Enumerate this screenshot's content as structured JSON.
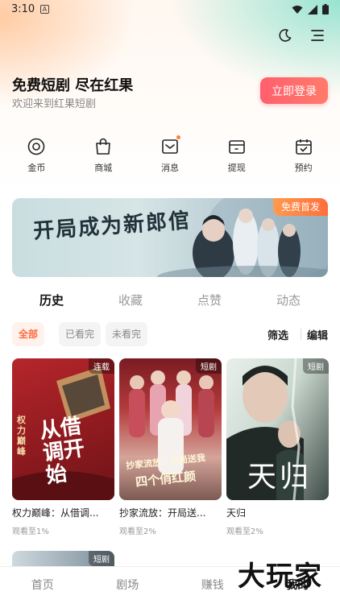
{
  "status_bar": {
    "time": "3:10",
    "notification_badge": "A",
    "icons": [
      "wifi-icon",
      "signal-icon",
      "battery-icon"
    ]
  },
  "header": {
    "icons": [
      "moon-icon",
      "menu-icon"
    ]
  },
  "hero": {
    "title": "免费短剧 尽在红果",
    "subtitle": "欢迎来到红果短剧",
    "login_label": "立即登录"
  },
  "quick_menu": [
    {
      "label": "金币",
      "icon": "coin-icon"
    },
    {
      "label": "商城",
      "icon": "shopping-bag-icon"
    },
    {
      "label": "消息",
      "icon": "message-icon",
      "has_dot": true
    },
    {
      "label": "提现",
      "icon": "wallet-icon"
    },
    {
      "label": "预约",
      "icon": "calendar-icon"
    }
  ],
  "banner": {
    "calligraphy": "开局成为新郎倌",
    "badge": "免费首发"
  },
  "tabs": [
    {
      "label": "历史",
      "active": true
    },
    {
      "label": "收藏",
      "active": false
    },
    {
      "label": "点赞",
      "active": false
    },
    {
      "label": "动态",
      "active": false
    }
  ],
  "filters": {
    "chips": [
      {
        "label": "全部",
        "active": true
      },
      {
        "label": "已看完",
        "active": false
      },
      {
        "label": "未看完",
        "active": false
      }
    ],
    "filter_label": "筛选",
    "edit_label": "编辑"
  },
  "cards": [
    {
      "title": "权力巅峰：从借调...",
      "progress": "观看至1%",
      "tag": "连载",
      "poster_text": "从借调开始",
      "poster_side": "权力巅峰"
    },
    {
      "title": "抄家流放：开局送...",
      "progress": "观看至2%",
      "tag": "短剧",
      "poster_text": "抄家流放：开局送我",
      "poster_text2": "四个俏红颜"
    },
    {
      "title": "天归",
      "progress": "观看至2%",
      "tag": "短剧",
      "poster_text": "天归"
    }
  ],
  "next_card": {
    "tag": "短剧"
  },
  "bottom_nav": [
    {
      "label": "首页",
      "active": false
    },
    {
      "label": "剧场",
      "active": false
    },
    {
      "label": "赚钱",
      "active": false
    },
    {
      "label": "我的",
      "active": true
    }
  ],
  "watermark": "大玩家",
  "colors": {
    "accent": "#ff6a3d",
    "login_gradient_start": "#ff5f6d",
    "badge_orange": "#ff7d3a"
  }
}
